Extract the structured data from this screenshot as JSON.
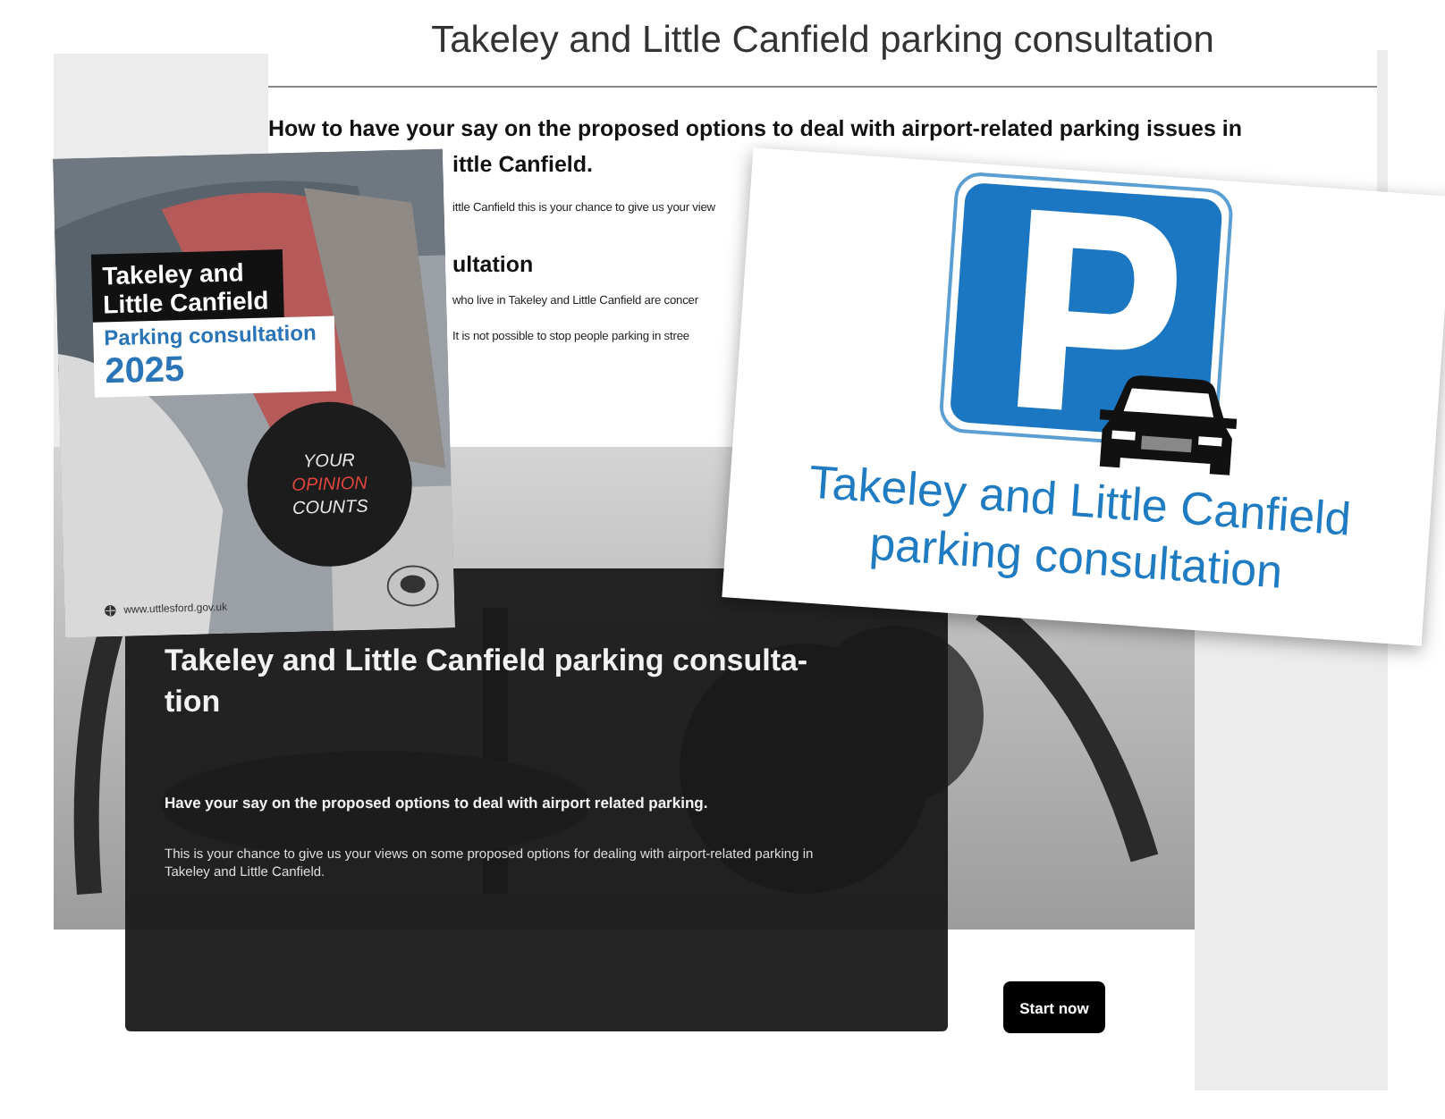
{
  "back_page": {
    "title": "Takeley and Little Canfield parking consultation",
    "heading_lines": [
      "How to have your say on the proposed options to deal with airport-related parking issues in",
      "ittle Canfield."
    ],
    "intro": "ittle Canfield this is your chance to give us your view",
    "subheading": "ultation",
    "paragraphs": [
      "who live in Takeley and Little Canfield are concer",
      "It is not possible to stop people parking in stree"
    ]
  },
  "leaflet": {
    "title_lines": [
      "Takeley and",
      "Little Canfield"
    ],
    "subtitle": "Parking consultation",
    "year": "2025",
    "badge": [
      {
        "text": "YOUR",
        "color": "#e8e8e8"
      },
      {
        "text": "OPINION",
        "color": "#e0463c"
      },
      {
        "text": "COUNTS",
        "color": "#e8e8e8"
      }
    ],
    "website": "www.uttlesford.gov.uk"
  },
  "sign_card": {
    "caption_lines": [
      "Takeley and Little Canfield",
      "parking consultation"
    ]
  },
  "hero": {
    "title_lines": [
      "Takeley and Little Canfield parking consulta-",
      "tion"
    ],
    "lead": "Have your say on the proposed options to deal with airport related parking.",
    "body": "This is your chance to give us your views on some proposed options for dealing with airport-related parking in Takeley and Little Canfield."
  },
  "start_button": "Start now"
}
